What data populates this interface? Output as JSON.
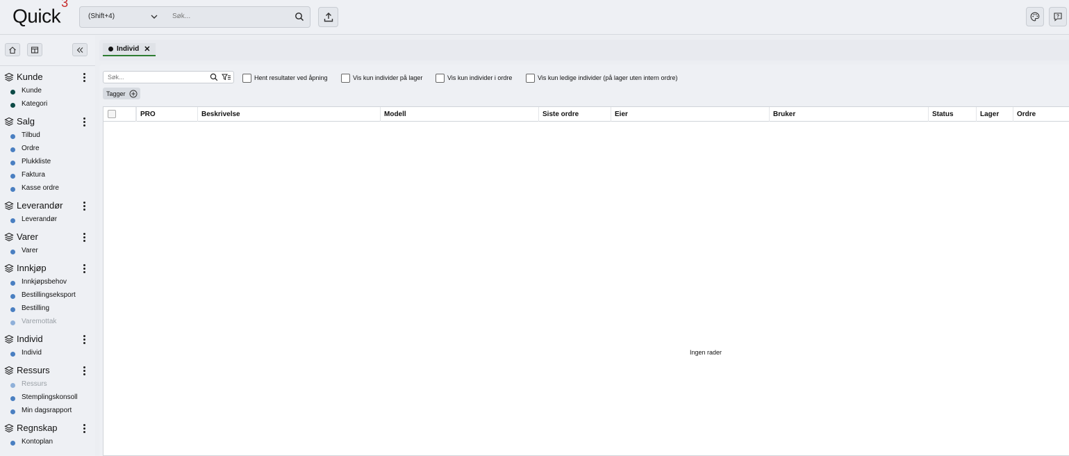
{
  "header": {
    "logo_text": "Quick",
    "logo_sup": "3",
    "search": {
      "scope": "(Shift+4)",
      "placeholder": "Søk..."
    }
  },
  "sidebar": {
    "sections": [
      {
        "title": "Kunde",
        "items": [
          {
            "label": "Kunde",
            "state": "dark"
          },
          {
            "label": "Kategori",
            "state": "dark"
          }
        ]
      },
      {
        "title": "Salg",
        "items": [
          {
            "label": "Tilbud"
          },
          {
            "label": "Ordre"
          },
          {
            "label": "Plukkliste"
          },
          {
            "label": "Faktura"
          },
          {
            "label": "Kasse ordre"
          }
        ]
      },
      {
        "title": "Leverandør",
        "items": [
          {
            "label": "Leverandør"
          }
        ]
      },
      {
        "title": "Varer",
        "items": [
          {
            "label": "Varer"
          }
        ]
      },
      {
        "title": "Innkjøp",
        "items": [
          {
            "label": "Innkjøpsbehov"
          },
          {
            "label": "Bestillingseksport"
          },
          {
            "label": "Bestilling"
          },
          {
            "label": "Varemottak",
            "state": "disabled"
          }
        ]
      },
      {
        "title": "Individ",
        "items": [
          {
            "label": "Individ"
          }
        ]
      },
      {
        "title": "Ressurs",
        "items": [
          {
            "label": "Ressurs",
            "state": "disabled"
          },
          {
            "label": "Stemplingskonsoll"
          },
          {
            "label": "Min dagsrapport"
          }
        ]
      },
      {
        "title": "Regnskap",
        "items": [
          {
            "label": "Kontoplan"
          }
        ]
      }
    ]
  },
  "tabs": [
    {
      "label": "Individ",
      "active": true
    }
  ],
  "filters": {
    "search_placeholder": "Søk...",
    "checkboxes": [
      {
        "label": "Hent resultater ved åpning",
        "checked": false
      },
      {
        "label": "Vis kun individer på lager",
        "checked": false
      },
      {
        "label": "Vis kun individer i ordre",
        "checked": false
      },
      {
        "label": "Vis kun ledige individer (på lager uten intern ordre)",
        "checked": false
      }
    ],
    "tags_label": "Tagger"
  },
  "grid": {
    "columns": [
      "PRO",
      "Beskrivelse",
      "Modell",
      "Siste ordre",
      "Eier",
      "Bruker",
      "Status",
      "Lager",
      "Ordre"
    ],
    "rows": [],
    "empty_text": "Ingen rader"
  },
  "colors": {
    "accent_green": "#2e7d32",
    "dot_blue": "#4a7fc1",
    "dot_dark": "#0c4a46",
    "logo_red": "#c62828"
  }
}
